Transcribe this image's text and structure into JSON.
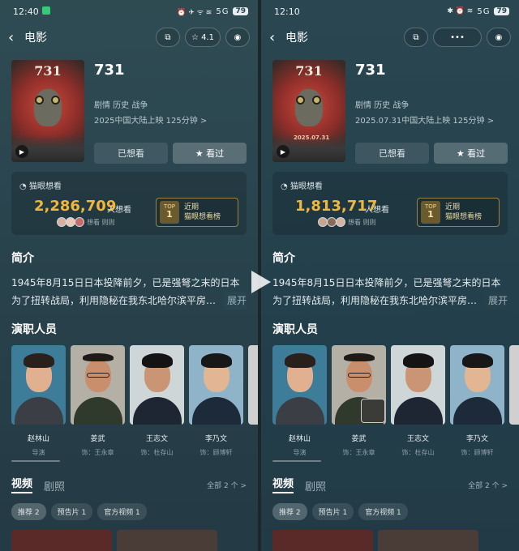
{
  "left": {
    "status": {
      "time": "12:40",
      "signal": "5G",
      "battery": "79"
    },
    "nav": {
      "title": "电影",
      "rating": "4.1"
    },
    "movie": {
      "title": "731",
      "genre": "剧情 历史 战争",
      "release": "2025中国大陆上映 125分钟 >",
      "poster_title": "731",
      "poster_date": ""
    },
    "buttons": {
      "want": "已想看",
      "seen": "看过"
    },
    "want": {
      "head": "猫眼想看",
      "count": "2,286,709",
      "unit": "人想看",
      "sub": "想看  则则",
      "top": "TOP",
      "top_num": "1",
      "rank_label": "近期",
      "rank_text": "猫眼想看榜"
    },
    "intro": {
      "title": "简介",
      "text": "1945年8月15日日本投降前夕，已是强弩之末的日本为了扭转战局，利用隐秘在我东北哈尔滨平房…",
      "more": "展开"
    },
    "cast_title": "演职人员",
    "cast": [
      {
        "name": "赵林山",
        "role": "导演"
      },
      {
        "name": "姜武",
        "role": "饰：王永章"
      },
      {
        "name": "王志文",
        "role": "饰：杜存山"
      },
      {
        "name": "李乃文",
        "role": "饰：顾博轩"
      }
    ],
    "tabs": {
      "video": "视频",
      "stills": "剧照",
      "all": "全部 2 个 >"
    },
    "chips": [
      "推荐 2",
      "预告片 1",
      "官方视频 1"
    ]
  },
  "right": {
    "status": {
      "time": "12:10",
      "signal": "5G",
      "battery": "79"
    },
    "nav": {
      "title": "电影",
      "more": "•••"
    },
    "movie": {
      "title": "731",
      "genre": "剧情 历史 战争",
      "release": "2025.07.31中国大陆上映 125分钟 >",
      "poster_title": "731",
      "poster_date": "2025.07.31"
    },
    "buttons": {
      "want": "已想看",
      "seen": "看过"
    },
    "want": {
      "head": "猫眼想看",
      "count": "1,813,717",
      "unit": "人想看",
      "sub": "想看  则则",
      "top": "TOP",
      "top_num": "1",
      "rank_label": "近期",
      "rank_text": "猫眼想看榜"
    },
    "intro": {
      "title": "简介",
      "text": "1945年8月15日日本投降前夕，已是强弩之末的日本为了扭转战局，利用隐秘在我东北哈尔滨平房…",
      "more": "展开"
    },
    "cast_title": "演职人员",
    "cast": [
      {
        "name": "赵林山",
        "role": "导演"
      },
      {
        "name": "姜武",
        "role": "饰：王永章"
      },
      {
        "name": "王志文",
        "role": "饰：杜存山"
      },
      {
        "name": "李乃文",
        "role": "饰：顾博轩"
      }
    ],
    "tabs": {
      "video": "视频",
      "stills": "剧照",
      "all": "全部 2 个 >"
    },
    "chips": [
      "推荐 2",
      "预告片 1",
      "官方视频 1"
    ]
  },
  "colors": {
    "accent_gold": "#f0b73c",
    "bg": "#2b4650"
  },
  "icons": [
    "back-icon",
    "share-icon",
    "star-icon",
    "record-icon",
    "more-icon",
    "play-icon",
    "eye-icon"
  ]
}
